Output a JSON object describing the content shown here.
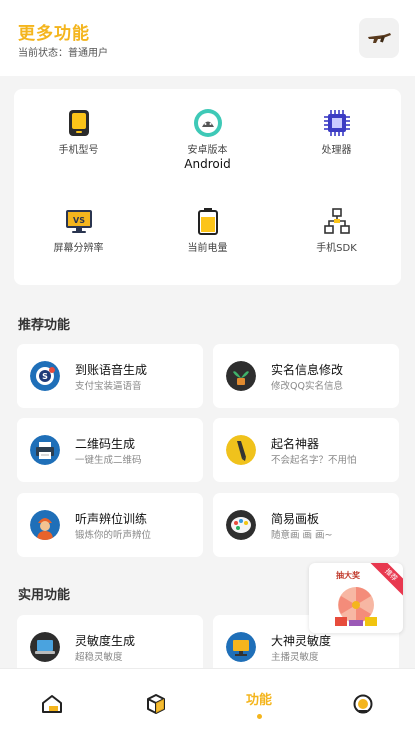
{
  "header": {
    "title": "更多功能",
    "status_label": "当前状态：",
    "status_value": "普通用户",
    "right_icon": "gun-icon"
  },
  "device_info": [
    {
      "label": "手机型号",
      "value": "",
      "icon": "phone-icon"
    },
    {
      "label": "安卓版本",
      "value": "Android",
      "icon": "android-icon"
    },
    {
      "label": "处理器",
      "value": "",
      "icon": "cpu-icon"
    },
    {
      "label": "屏幕分辨率",
      "value": "",
      "icon": "monitor-icon"
    },
    {
      "label": "当前电量",
      "value": "",
      "icon": "battery-icon"
    },
    {
      "label": "手机SDK",
      "value": "",
      "icon": "network-icon"
    }
  ],
  "recommended": {
    "title": "推荐功能",
    "items": [
      {
        "name": "到账语音生成",
        "desc": "支付宝装逼语音",
        "icon": "payment-voice-icon"
      },
      {
        "name": "实名信息修改",
        "desc": "修改QQ实名信息",
        "icon": "plant-icon"
      },
      {
        "name": "二维码生成",
        "desc": "一键生成二维码",
        "icon": "printer-icon"
      },
      {
        "name": "起名神器",
        "desc": "不会起名字？不用怕",
        "icon": "pen-icon"
      },
      {
        "name": "听声辨位训练",
        "desc": "锻炼你的听声辨位",
        "icon": "worker-icon"
      },
      {
        "name": "简易画板",
        "desc": "随意画 画 画~",
        "icon": "palette-icon"
      }
    ]
  },
  "practical": {
    "title": "实用功能",
    "items": [
      {
        "name": "灵敏度生成",
        "desc": "超稳灵敏度",
        "icon": "laptop-icon"
      },
      {
        "name": "大神灵敏度",
        "desc": "主播灵敏度",
        "icon": "computer-icon"
      }
    ]
  },
  "promo": {
    "title": "抽大奖",
    "ribbon": "推荐"
  },
  "tabbar": {
    "active_label": "功能"
  },
  "colors": {
    "accent": "#f4b51d",
    "background": "#f4f4f4"
  }
}
